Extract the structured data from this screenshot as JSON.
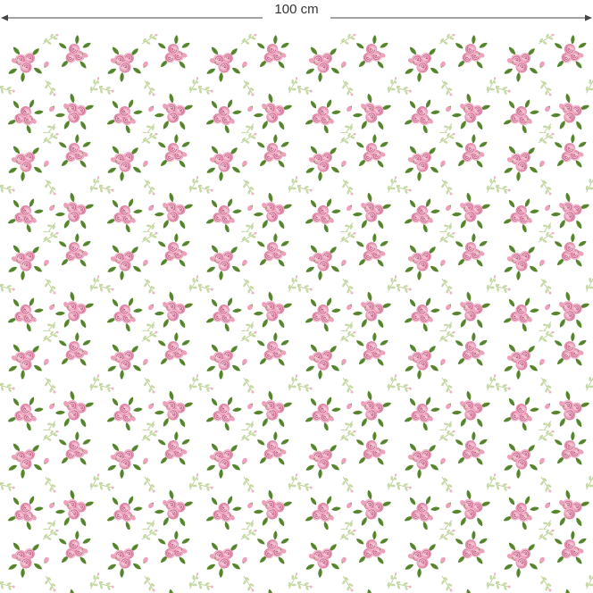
{
  "dimension": {
    "label": "100 cm"
  },
  "colors": {
    "background": "#ffffff",
    "arrow_line": "#444444",
    "label_text": "#333333",
    "rose_light": "#f5c9d8",
    "rose_mid": "#ec9fba",
    "rose_dark": "#d16a8e",
    "leaf_dark": "#4f7f2e",
    "leaf_mid": "#78a446",
    "leaf_light": "#c7d9a4"
  },
  "pattern": {
    "motif": "pink-rose-bouquet",
    "secondary_motif": "small-leaf-sprig"
  }
}
